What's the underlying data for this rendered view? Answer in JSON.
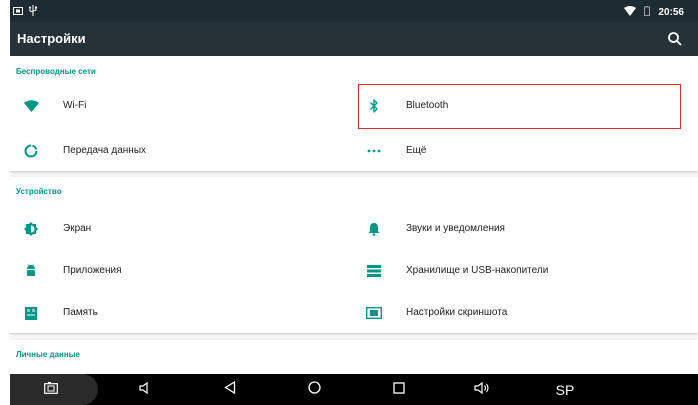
{
  "colors": {
    "status_bar": "#1f2b32",
    "app_bar": "#263238",
    "accent": "#009688",
    "highlight": "#d32f2f",
    "background": "#f5f5f5"
  },
  "status_bar": {
    "time": "20:56",
    "icons": [
      "screenshot-icon",
      "usb-icon",
      "wifi-signal-icon",
      "battery-icon"
    ]
  },
  "app_bar": {
    "title": "Настройки",
    "search_icon": "search-icon"
  },
  "sections": [
    {
      "header": "Беспроводные сети",
      "items": [
        {
          "label": "Wi-Fi",
          "icon": "wifi-icon"
        },
        {
          "label": "Bluetooth",
          "icon": "bluetooth-icon"
        },
        {
          "label": "Передача данных",
          "icon": "data-usage-icon"
        },
        {
          "label": "Ещё",
          "icon": "more-icon"
        }
      ]
    },
    {
      "header": "Устройство",
      "items": [
        {
          "label": "Экран",
          "icon": "brightness-icon"
        },
        {
          "label": "Звуки и уведомления",
          "icon": "bell-icon"
        },
        {
          "label": "Приложения",
          "icon": "android-icon"
        },
        {
          "label": "Хранилище и USB-накопители",
          "icon": "storage-icon"
        },
        {
          "label": "Память",
          "icon": "memory-icon"
        },
        {
          "label": "Настройки скриншота",
          "icon": "screenshot-settings-icon"
        }
      ]
    },
    {
      "header": "Личные данные",
      "items": []
    }
  ],
  "nav_bar": {
    "buttons": [
      "screenshot-icon",
      "volume-down-icon",
      "back-icon",
      "home-icon",
      "recents-icon",
      "volume-up-icon"
    ],
    "sp_label": "SP"
  }
}
